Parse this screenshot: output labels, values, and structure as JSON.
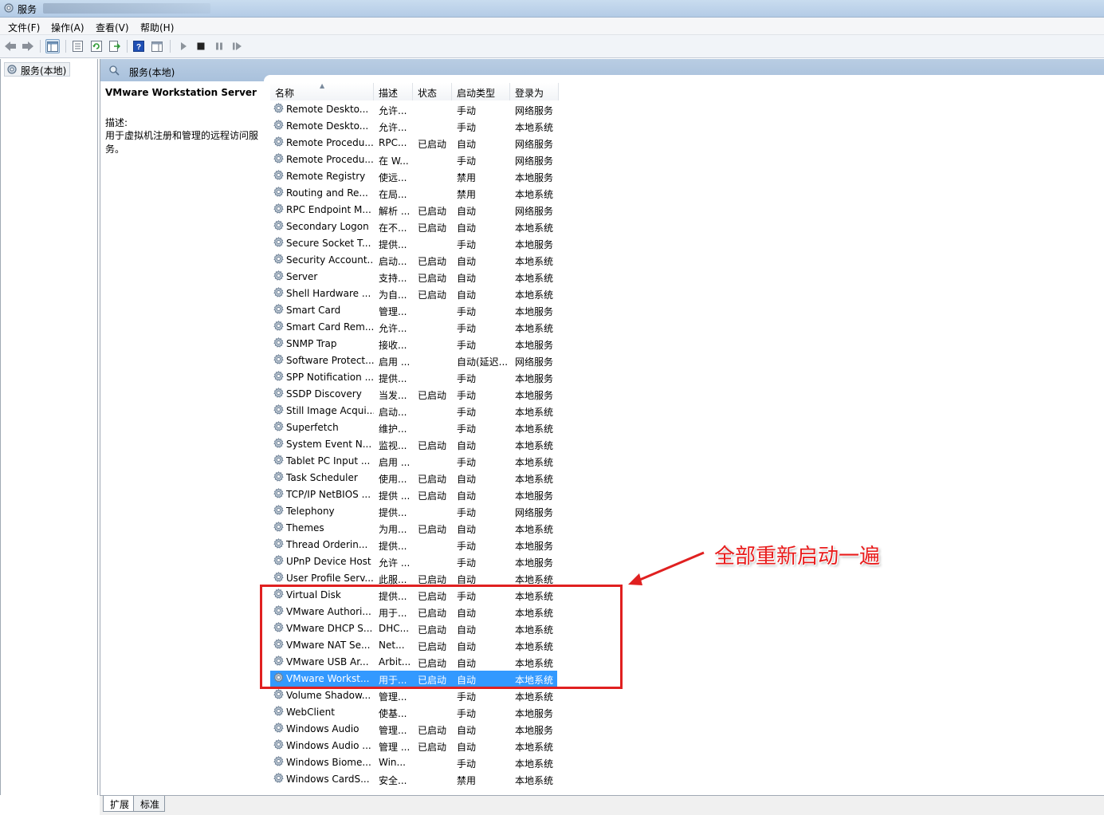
{
  "window": {
    "title": "服务"
  },
  "menu": {
    "file": "文件(F)",
    "action": "操作(A)",
    "view": "查看(V)",
    "help": "帮助(H)"
  },
  "tree": {
    "root": "服务(本地)"
  },
  "pane_header": "服务(本地)",
  "details": {
    "service_name": "VMware Workstation Server",
    "desc_label": "描述:",
    "desc_text": "用于虚拟机注册和管理的远程访问服务。"
  },
  "columns": {
    "name": "名称",
    "desc": "描述",
    "status": "状态",
    "startup": "启动类型",
    "logon": "登录为"
  },
  "rows": [
    {
      "name": "Remote Deskto...",
      "desc": "允许...",
      "status": "",
      "startup": "手动",
      "logon": "网络服务"
    },
    {
      "name": "Remote Deskto...",
      "desc": "允许...",
      "status": "",
      "startup": "手动",
      "logon": "本地系统"
    },
    {
      "name": "Remote Procedu...",
      "desc": "RPC...",
      "status": "已启动",
      "startup": "自动",
      "logon": "网络服务"
    },
    {
      "name": "Remote Procedu...",
      "desc": "在 W...",
      "status": "",
      "startup": "手动",
      "logon": "网络服务"
    },
    {
      "name": "Remote Registry",
      "desc": "使远...",
      "status": "",
      "startup": "禁用",
      "logon": "本地服务"
    },
    {
      "name": "Routing and Re...",
      "desc": "在局...",
      "status": "",
      "startup": "禁用",
      "logon": "本地系统"
    },
    {
      "name": "RPC Endpoint M...",
      "desc": "解析 ...",
      "status": "已启动",
      "startup": "自动",
      "logon": "网络服务"
    },
    {
      "name": "Secondary Logon",
      "desc": "在不...",
      "status": "已启动",
      "startup": "自动",
      "logon": "本地系统"
    },
    {
      "name": "Secure Socket T...",
      "desc": "提供...",
      "status": "",
      "startup": "手动",
      "logon": "本地服务"
    },
    {
      "name": "Security Account...",
      "desc": "启动...",
      "status": "已启动",
      "startup": "自动",
      "logon": "本地系统"
    },
    {
      "name": "Server",
      "desc": "支持...",
      "status": "已启动",
      "startup": "自动",
      "logon": "本地系统"
    },
    {
      "name": "Shell Hardware ...",
      "desc": "为自...",
      "status": "已启动",
      "startup": "自动",
      "logon": "本地系统"
    },
    {
      "name": "Smart Card",
      "desc": "管理...",
      "status": "",
      "startup": "手动",
      "logon": "本地服务"
    },
    {
      "name": "Smart Card Rem...",
      "desc": "允许...",
      "status": "",
      "startup": "手动",
      "logon": "本地系统"
    },
    {
      "name": "SNMP Trap",
      "desc": "接收...",
      "status": "",
      "startup": "手动",
      "logon": "本地服务"
    },
    {
      "name": "Software Protect...",
      "desc": "启用 ...",
      "status": "",
      "startup": "自动(延迟...",
      "logon": "网络服务"
    },
    {
      "name": "SPP Notification ...",
      "desc": "提供...",
      "status": "",
      "startup": "手动",
      "logon": "本地服务"
    },
    {
      "name": "SSDP Discovery",
      "desc": "当发...",
      "status": "已启动",
      "startup": "手动",
      "logon": "本地服务"
    },
    {
      "name": "Still Image Acqui...",
      "desc": "启动...",
      "status": "",
      "startup": "手动",
      "logon": "本地系统"
    },
    {
      "name": "Superfetch",
      "desc": "维护...",
      "status": "",
      "startup": "手动",
      "logon": "本地系统"
    },
    {
      "name": "System Event N...",
      "desc": "监视...",
      "status": "已启动",
      "startup": "自动",
      "logon": "本地系统"
    },
    {
      "name": "Tablet PC Input ...",
      "desc": "启用 ...",
      "status": "",
      "startup": "手动",
      "logon": "本地系统"
    },
    {
      "name": "Task Scheduler",
      "desc": "使用...",
      "status": "已启动",
      "startup": "自动",
      "logon": "本地系统"
    },
    {
      "name": "TCP/IP NetBIOS ...",
      "desc": "提供 ...",
      "status": "已启动",
      "startup": "自动",
      "logon": "本地服务"
    },
    {
      "name": "Telephony",
      "desc": "提供...",
      "status": "",
      "startup": "手动",
      "logon": "网络服务"
    },
    {
      "name": "Themes",
      "desc": "为用...",
      "status": "已启动",
      "startup": "自动",
      "logon": "本地系统"
    },
    {
      "name": "Thread Orderin...",
      "desc": "提供...",
      "status": "",
      "startup": "手动",
      "logon": "本地服务"
    },
    {
      "name": "UPnP Device Host",
      "desc": "允许 ...",
      "status": "",
      "startup": "手动",
      "logon": "本地服务"
    },
    {
      "name": "User Profile Serv...",
      "desc": "此服...",
      "status": "已启动",
      "startup": "自动",
      "logon": "本地系统"
    },
    {
      "name": "Virtual Disk",
      "desc": "提供...",
      "status": "已启动",
      "startup": "手动",
      "logon": "本地系统"
    },
    {
      "name": "VMware Authori...",
      "desc": "用于...",
      "status": "已启动",
      "startup": "自动",
      "logon": "本地系统"
    },
    {
      "name": "VMware DHCP S...",
      "desc": "DHC...",
      "status": "已启动",
      "startup": "自动",
      "logon": "本地系统"
    },
    {
      "name": "VMware NAT Se...",
      "desc": "Net...",
      "status": "已启动",
      "startup": "自动",
      "logon": "本地系统"
    },
    {
      "name": "VMware USB Ar...",
      "desc": "Arbit...",
      "status": "已启动",
      "startup": "自动",
      "logon": "本地系统"
    },
    {
      "name": "VMware Workst...",
      "desc": "用于...",
      "status": "已启动",
      "startup": "自动",
      "logon": "本地系统",
      "selected": true
    },
    {
      "name": "Volume Shadow...",
      "desc": "管理...",
      "status": "",
      "startup": "手动",
      "logon": "本地系统"
    },
    {
      "name": "WebClient",
      "desc": "使基...",
      "status": "",
      "startup": "手动",
      "logon": "本地服务"
    },
    {
      "name": "Windows Audio",
      "desc": "管理...",
      "status": "已启动",
      "startup": "自动",
      "logon": "本地服务"
    },
    {
      "name": "Windows Audio ...",
      "desc": "管理 ...",
      "status": "已启动",
      "startup": "自动",
      "logon": "本地系统"
    },
    {
      "name": "Windows Biome...",
      "desc": "Win...",
      "status": "",
      "startup": "手动",
      "logon": "本地系统"
    },
    {
      "name": "Windows CardS...",
      "desc": "安全...",
      "status": "",
      "startup": "禁用",
      "logon": "本地系统"
    }
  ],
  "tabs": {
    "extended": "扩展",
    "standard": "标准"
  },
  "annotation": {
    "text": "全部重新启动一遍",
    "color": "#e81c1c"
  },
  "colors": {
    "selection": "#3399ff",
    "header": "#b9cde3"
  }
}
